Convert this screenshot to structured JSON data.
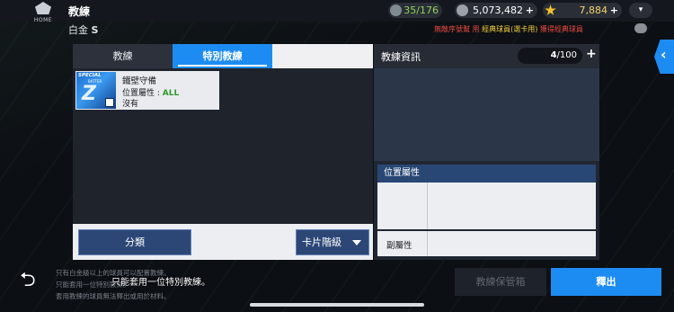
{
  "header": {
    "home_label": "HOME",
    "title": "教練",
    "subtitle": "白金",
    "subtitle_icon": "S",
    "resources": {
      "players_count": "35/176",
      "coins": "5,073,482",
      "stars": "7,884"
    },
    "marquee_prefix": "無敵序號幫 用",
    "marquee_highlight": "經典球員(選卡用)",
    "marquee_suffix": "獲得經典球員",
    "menu_glyph": "▾"
  },
  "tabs": [
    {
      "label": "教練"
    },
    {
      "label": "特別教練"
    }
  ],
  "card": {
    "image_text": "SPECIAL",
    "image_subtext": "BATTER",
    "image_glyph": "Z",
    "name": "鐵壁守備",
    "position_label": "位置屬性 : ",
    "position_value": "ALL",
    "status": "沒有"
  },
  "left_bottom": {
    "category_button": "分類",
    "sort_select": "卡片階級"
  },
  "info_panel": {
    "title": "教練資訊",
    "count_current": "4",
    "count_sep": "/100",
    "add_glyph": "+",
    "position_attr_header": "位置屬性",
    "sub_attr_label": "副屬性"
  },
  "side_tab_glyph": "‹",
  "footer": {
    "back_glyph": "⮌",
    "note_1": "只有白金級以上的球員可以配置教練。",
    "note_2": "只能套用一位特別教練。",
    "note_3": "套用教練的球員無法釋出或用於材料。",
    "toast": "只能套用一位特別教練。",
    "vault_button": "教練保管箱",
    "release_button": "釋出"
  },
  "colors": {
    "accent": "#1d8cf2",
    "panel_dark": "#1f232c",
    "button_navy": "#2c4776",
    "green_value": "#2f9a2c",
    "red_text": "#e84a3e"
  }
}
